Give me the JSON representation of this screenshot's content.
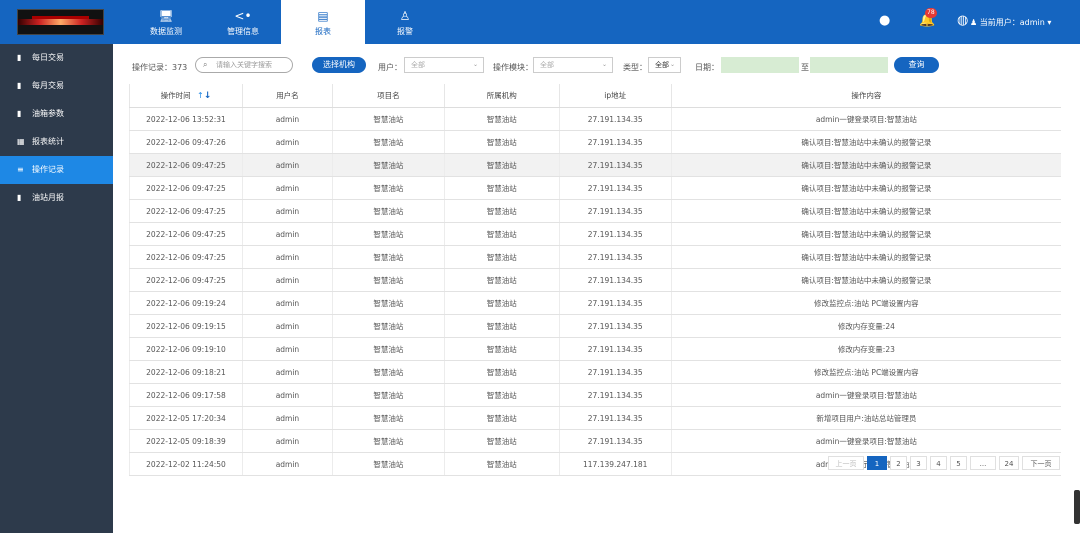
{
  "topnav": {
    "items": [
      {
        "label": "数据监测",
        "icon": "monitor-icon"
      },
      {
        "label": "管理信息",
        "icon": "share-icon"
      },
      {
        "label": "报表",
        "icon": "document-icon"
      },
      {
        "label": "报警",
        "icon": "alarm-person-icon"
      }
    ],
    "active_index": 2,
    "notification_count": "78",
    "user_label": "当前用户：admin"
  },
  "sidebar": {
    "items": [
      {
        "label": "每日交易",
        "icon": "file-icon"
      },
      {
        "label": "每月交易",
        "icon": "file-icon"
      },
      {
        "label": "油箱参数",
        "icon": "file-icon"
      },
      {
        "label": "报表统计",
        "icon": "grid-icon"
      },
      {
        "label": "操作记录",
        "icon": "list-icon"
      },
      {
        "label": "油站月报",
        "icon": "file-icon"
      }
    ],
    "active_index": 4
  },
  "filter": {
    "record_count_label": "操作记录：373",
    "search_placeholder": "请输入关键字搜索",
    "select_org_button": "选择机构",
    "user_label": "用户：",
    "user_value": "全部",
    "module_label": "操作模块：",
    "module_value": "全部",
    "type_label": "类型：",
    "type_value": "全部",
    "date_label": "日期：",
    "date_sep": "至",
    "query_button": "查询"
  },
  "table": {
    "columns": [
      "操作时间",
      "用户名",
      "项目名",
      "所属机构",
      "ip地址",
      "操作内容"
    ],
    "rows": [
      [
        "2022-12-06 13:52:31",
        "admin",
        "智慧油站",
        "智慧油站",
        "27.191.134.35",
        "admin一键登录项目:智慧油站"
      ],
      [
        "2022-12-06 09:47:26",
        "admin",
        "智慧油站",
        "智慧油站",
        "27.191.134.35",
        "确认项目:智慧油站中未确认的报警记录"
      ],
      [
        "2022-12-06 09:47:25",
        "admin",
        "智慧油站",
        "智慧油站",
        "27.191.134.35",
        "确认项目:智慧油站中未确认的报警记录"
      ],
      [
        "2022-12-06 09:47:25",
        "admin",
        "智慧油站",
        "智慧油站",
        "27.191.134.35",
        "确认项目:智慧油站中未确认的报警记录"
      ],
      [
        "2022-12-06 09:47:25",
        "admin",
        "智慧油站",
        "智慧油站",
        "27.191.134.35",
        "确认项目:智慧油站中未确认的报警记录"
      ],
      [
        "2022-12-06 09:47:25",
        "admin",
        "智慧油站",
        "智慧油站",
        "27.191.134.35",
        "确认项目:智慧油站中未确认的报警记录"
      ],
      [
        "2022-12-06 09:47:25",
        "admin",
        "智慧油站",
        "智慧油站",
        "27.191.134.35",
        "确认项目:智慧油站中未确认的报警记录"
      ],
      [
        "2022-12-06 09:47:25",
        "admin",
        "智慧油站",
        "智慧油站",
        "27.191.134.35",
        "确认项目:智慧油站中未确认的报警记录"
      ],
      [
        "2022-12-06 09:19:24",
        "admin",
        "智慧油站",
        "智慧油站",
        "27.191.134.35",
        "修改监控点:油站 PC端设置内容"
      ],
      [
        "2022-12-06 09:19:15",
        "admin",
        "智慧油站",
        "智慧油站",
        "27.191.134.35",
        "修改内存变量:24"
      ],
      [
        "2022-12-06 09:19:10",
        "admin",
        "智慧油站",
        "智慧油站",
        "27.191.134.35",
        "修改内存变量:23"
      ],
      [
        "2022-12-06 09:18:21",
        "admin",
        "智慧油站",
        "智慧油站",
        "27.191.134.35",
        "修改监控点:油站 PC端设置内容"
      ],
      [
        "2022-12-06 09:17:58",
        "admin",
        "智慧油站",
        "智慧油站",
        "27.191.134.35",
        "admin一键登录项目:智慧油站"
      ],
      [
        "2022-12-05 17:20:34",
        "admin",
        "智慧油站",
        "智慧油站",
        "27.191.134.35",
        "新增项目用户:油站总站管理员"
      ],
      [
        "2022-12-05 09:18:39",
        "admin",
        "智慧油站",
        "智慧油站",
        "27.191.134.35",
        "admin一键登录项目:智慧油站"
      ],
      [
        "2022-12-02 11:24:50",
        "admin",
        "智慧油站",
        "智慧油站",
        "117.139.247.181",
        "admin登录演示项目:智慧油站"
      ]
    ],
    "highlighted_row": 2
  },
  "pagination": {
    "prev": "上一页",
    "pages": [
      "1",
      "2",
      "3",
      "4",
      "5",
      "...",
      "24"
    ],
    "next": "下一页",
    "current": "1"
  },
  "colors": {
    "brand": "#1565c0",
    "sidebar_bg": "#2d3a4b",
    "sidebar_active": "#1e88e5",
    "date_field": "#d7ecd3",
    "badge": "#e53935"
  }
}
